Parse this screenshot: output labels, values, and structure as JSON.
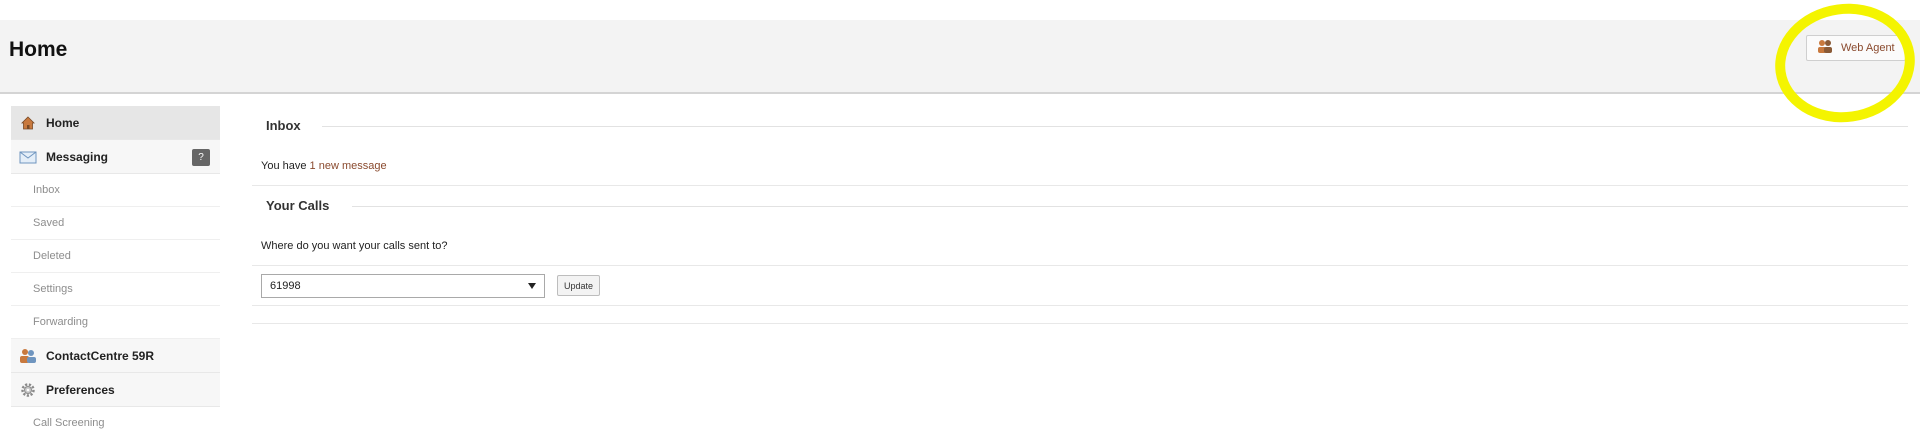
{
  "header": {
    "title": "Home",
    "web_agent_label": "Web Agent"
  },
  "sidebar": {
    "home_label": "Home",
    "messaging_label": "Messaging",
    "messaging_badge": "?",
    "messaging_sub": [
      "Inbox",
      "Saved",
      "Deleted",
      "Settings",
      "Forwarding"
    ],
    "contact_centre_label": "ContactCentre 59R",
    "preferences_label": "Preferences",
    "preferences_sub": [
      "Call Screening"
    ]
  },
  "main": {
    "inbox_title": "Inbox",
    "inbox_text": "You have",
    "inbox_link": "1 new message",
    "calls_title": "Your Calls",
    "calls_question": "Where do you want your calls sent to?",
    "calls_select_value": "61998",
    "update_label": "Update"
  },
  "colors": {
    "highlight": "#f4f400",
    "link": "#8a4a2e",
    "header_bg": "#f3f3f3"
  }
}
